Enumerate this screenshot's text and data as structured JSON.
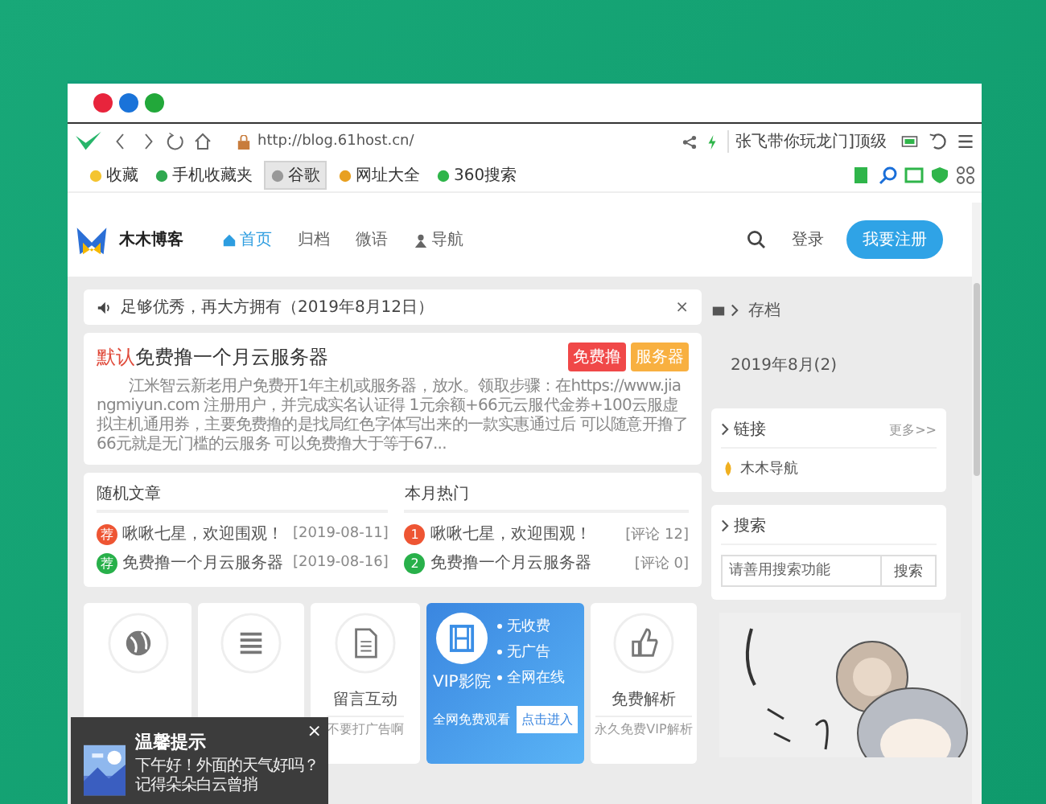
{
  "window_buttons": [
    {
      "color": "#e8243c"
    },
    {
      "color": "#1a73d9"
    },
    {
      "color": "#22a83a"
    }
  ],
  "address_bar": {
    "url": "http://blog.61host.cn/"
  },
  "browser_search": {
    "value": "张飞带你玩龙门]顶级"
  },
  "bookmarks": [
    {
      "label": "收藏",
      "selected": false
    },
    {
      "label": "手机收藏夹",
      "selected": false
    },
    {
      "label": "谷歌",
      "selected": true
    },
    {
      "label": "网址大全",
      "selected": false
    },
    {
      "label": "360搜索",
      "selected": false
    }
  ],
  "site": {
    "logo": "木木博客",
    "nav": [
      {
        "label": "首页",
        "selected": true
      },
      {
        "label": "归档",
        "selected": false
      },
      {
        "label": "微语",
        "selected": false
      },
      {
        "label": "导航",
        "selected": false
      }
    ],
    "login": "登录",
    "register": "我要注册"
  },
  "notice": {
    "text": "足够优秀，再大方拥有（2019年8月12日）",
    "close": "×"
  },
  "post": {
    "prefix": "默认",
    "title": "免费撸一个月云服务器",
    "tags": [
      {
        "label": "免费撸",
        "color": "#f04848"
      },
      {
        "label": "服务器",
        "color": "#f8b040"
      }
    ],
    "excerpt": "江米智云新老用户免费开1年主机或服务器，放水。领取步骤：在https://www.jiangmiyun.com 注册用户，并完成实名认证得 1元余额+66元云服代金券+100云服虚拟主机通用券，主要免费撸的是找局红色字体写出来的一款实惠通过后 可以随意开撸了 66元就是无门槛的云服务 可以免费撸大于等于67..."
  },
  "random_posts": {
    "title": "随机文章",
    "items": [
      {
        "badge": "荐",
        "title": "啾啾七星，欢迎围观！",
        "meta": "[2019-08-11]",
        "color": "#ee5533"
      },
      {
        "badge": "荐",
        "title": "免费撸一个月云服务器",
        "meta": "[2019-08-16]",
        "color": "#28b04a"
      }
    ]
  },
  "hot_posts": {
    "title": "本月热门",
    "items": [
      {
        "badge": "1",
        "title": "啾啾七星，欢迎围观！",
        "meta": "[评论 12]",
        "color": "#ee5533"
      },
      {
        "badge": "2",
        "title": "免费撸一个月云服务器",
        "meta": "[评论 0]",
        "color": "#28b04a"
      }
    ]
  },
  "sidebar": {
    "breadcrumb": "存档",
    "archive": [
      "2019年8月(2)"
    ],
    "links": {
      "title": "链接",
      "more": "更多>>",
      "items": [
        "木木导航"
      ]
    },
    "search": {
      "title": "搜索",
      "placeholder": "请善用搜索功能",
      "button": "搜索"
    }
  },
  "features": [
    {
      "kind": "basic"
    },
    {
      "kind": "basic"
    },
    {
      "kind": "basic",
      "title": "留言互动",
      "subtitle": "不要打广告啊"
    },
    {
      "kind": "vip",
      "title": "VIP影院",
      "bullets": [
        "无收费",
        "无广告",
        "全网在线"
      ],
      "footer": "全网免费观看",
      "button": "点击进入"
    },
    {
      "kind": "basic",
      "title": "免费解析",
      "subtitle": "永久免费VIP解析"
    }
  ],
  "popup": {
    "title": "温馨提示",
    "close": "×",
    "text": "下午好！外面的天气好吗？记得朵朵白云曾捎"
  }
}
